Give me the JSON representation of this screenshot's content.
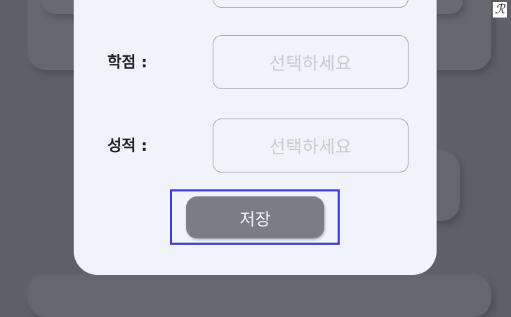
{
  "form": {
    "fields": [
      {
        "label": "학점 :",
        "placeholder": "선택하세요"
      },
      {
        "label": "성적 :",
        "placeholder": "선택하세요"
      }
    ],
    "save_label": "저장"
  },
  "badge": {
    "text": "ℛ"
  },
  "colors": {
    "backdrop": "#5f6067",
    "modal_background": "#f1f3fa",
    "field_border": "#a3a3ab",
    "placeholder_text": "#c8c9d2",
    "save_button": "#7b7d86",
    "highlight": "#3a3fd8"
  }
}
